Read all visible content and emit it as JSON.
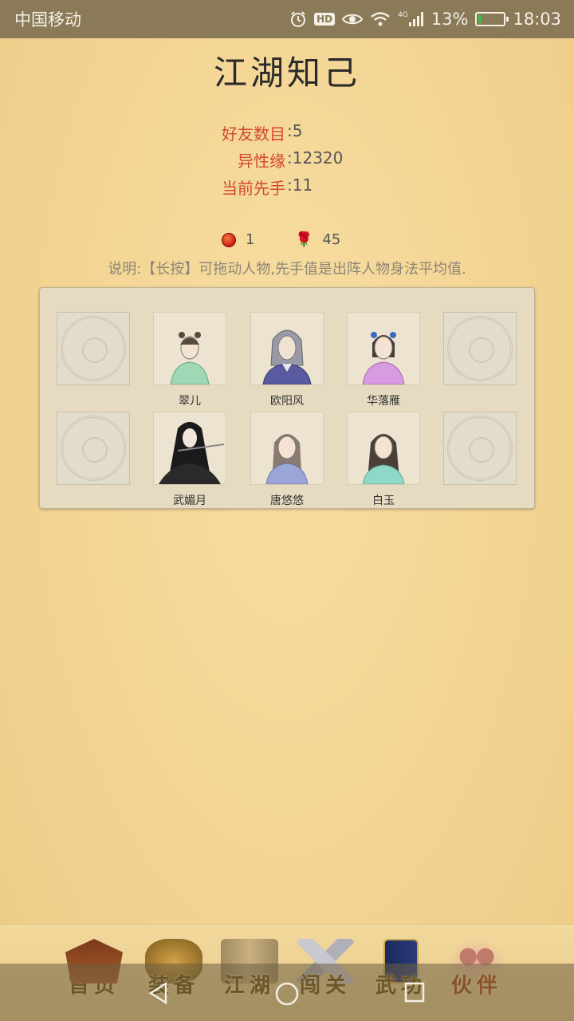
{
  "status_bar": {
    "carrier": "中国移动",
    "hd": "HD",
    "network": "4G",
    "battery": "13%",
    "battery_level": 0.13,
    "time": "18:03"
  },
  "page": {
    "title": "江湖知己"
  },
  "stats": [
    {
      "label": "好友数目",
      "value": ":5"
    },
    {
      "label": "异性缘",
      "value": ":12320"
    },
    {
      "label": "当前先手",
      "value": ":11"
    }
  ],
  "resources": {
    "gem_count": "1",
    "rose_count": "45"
  },
  "hint": "说明:【长按】可拖动人物,先手值是出阵人物身法平均值.",
  "team": {
    "row1": [
      "",
      "翠儿",
      "欧阳风",
      "华落雁",
      ""
    ],
    "row2": [
      "",
      "武媚月",
      "唐悠悠",
      "白玉",
      ""
    ]
  },
  "nav": {
    "items": [
      {
        "label": "首页"
      },
      {
        "label": "装备"
      },
      {
        "label": "江湖"
      },
      {
        "label": "闯关"
      },
      {
        "label": "武功"
      },
      {
        "label": "伙伴"
      }
    ],
    "active": "伙伴"
  },
  "colors": {
    "accent_red": "#d2482e",
    "background": "#f3d493",
    "status_bar": "#8a7a58"
  }
}
